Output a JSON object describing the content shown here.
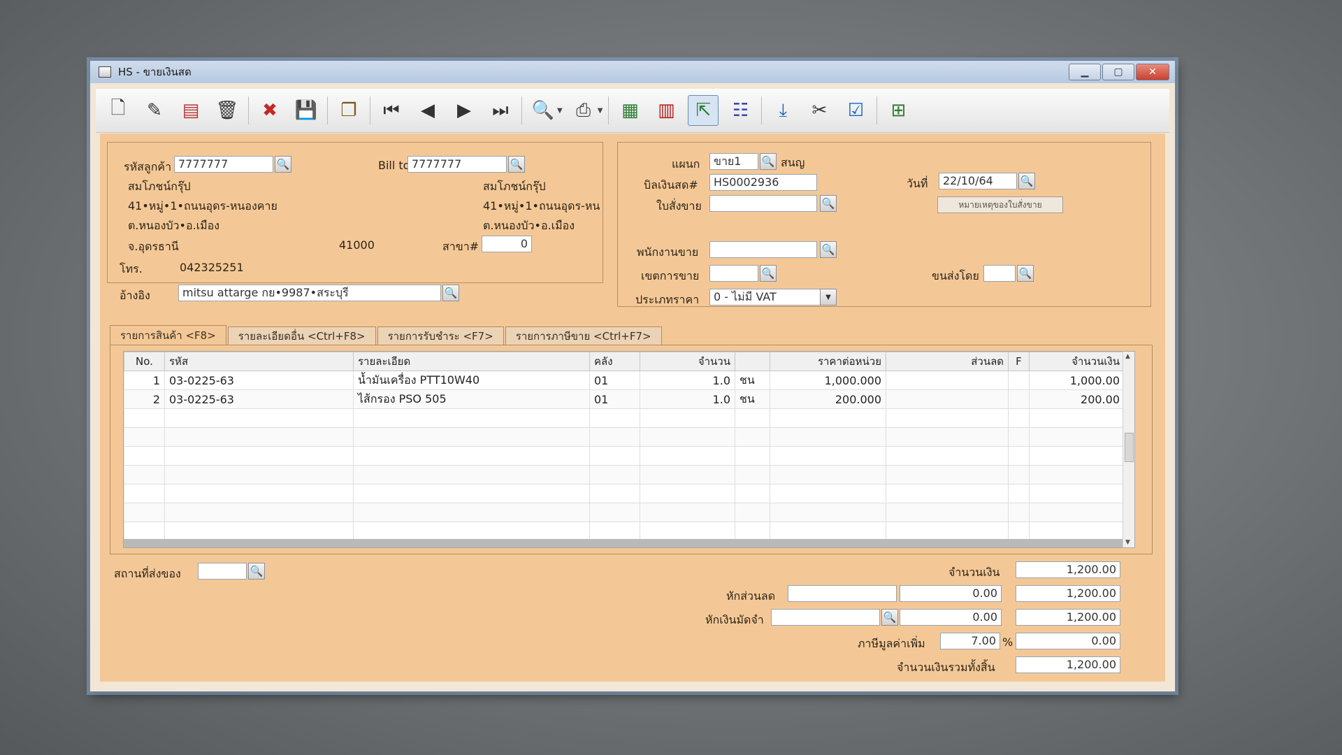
{
  "window": {
    "title": "HS - ขายเงินสด"
  },
  "toolbar": {
    "icons": [
      "new-doc-icon",
      "edit-icon",
      "void-icon",
      "trash-icon",
      "cancel-icon",
      "save-icon",
      "copy-icon",
      "first-icon",
      "prev-icon",
      "next-icon",
      "last-icon",
      "find-icon",
      "print-icon",
      "calc-icon",
      "register-icon",
      "checkout-icon",
      "report-icon",
      "approve-icon",
      "tools-icon",
      "ok-icon",
      "gift-icon"
    ]
  },
  "customer": {
    "code_label": "รหัสลูกค้า",
    "code": "7777777",
    "name": "สมโภชน์กรุ๊ป",
    "address1": "41•หมู่•1•ถนนอุดร-หนองคาย",
    "address2": "ต.หนองบัว•อ.เมือง",
    "province": "จ.อุดรธานี",
    "zip": "41000",
    "phone_label": "โทร.",
    "phone": "042325251",
    "ref_label": "อ้างอิง",
    "ref": "mitsu attarge กย•9987•สระบุรี"
  },
  "billto": {
    "label": "Bill to",
    "code": "7777777",
    "name": "สมโภชน์กรุ๊ป",
    "address1": "41•หมู่•1•ถนนอุดร-หน",
    "address2": "ต.หนองบัว•อ.เมือง",
    "branch_label": "สาขา#",
    "branch": "0"
  },
  "doc": {
    "dept_label": "แผนก",
    "dept": "ขาย1",
    "dept_name": "สนญ",
    "bill_label": "บิลเงินสด#",
    "bill": "HS0002936",
    "date_label": "วันที่",
    "date": "22/10/64",
    "order_label": "ใบสั่งขาย",
    "order": "",
    "note_button": "หมายเหตุของใบสั่งขาย",
    "sales_label": "พนักงานขาย",
    "sales": "",
    "area_label": "เขตการขาย",
    "area": "",
    "ship_label": "ขนส่งโดย",
    "ship": "",
    "price_label": "ประเภทราคา",
    "price_type": "0 - ไม่มี VAT"
  },
  "tabs": [
    "รายการสินค้า <F8>",
    "รายละเอียดอื่น <Ctrl+F8>",
    "รายการรับชำระ <F7>",
    "รายการภาษีขาย <Ctrl+F7>"
  ],
  "grid": {
    "headers": [
      "No.",
      "รหัส",
      "รายละเอียด",
      "คลัง",
      "จำนวน",
      "",
      "ราคาต่อหน่วย",
      "ส่วนลด",
      "F",
      "จำนวนเงิน"
    ],
    "rows": [
      {
        "no": "1",
        "code": "03-0225-63",
        "desc": "น้ำมันเครื่อง PTT10W40",
        "wh": "01",
        "qty": "1.0",
        "unit": "ชน",
        "price": "1,000.000",
        "disc": "",
        "f": "",
        "amount": "1,000.00"
      },
      {
        "no": "2",
        "code": "03-0225-63",
        "desc": "ไส้กรอง PSO 505",
        "wh": "01",
        "qty": "1.0",
        "unit": "ชน",
        "price": "200.000",
        "disc": "",
        "f": "",
        "amount": "200.00"
      }
    ]
  },
  "footer": {
    "place_label": "สถานที่ส่งของ",
    "place": "",
    "amount_label": "จำนวนเงิน",
    "amount": "1,200.00",
    "discount_label": "หักส่วนลด",
    "discount_code": "",
    "discount": "0.00",
    "after_discount": "1,200.00",
    "deposit_label": "หักเงินมัดจำ",
    "deposit_code": "",
    "deposit": "0.00",
    "after_deposit": "1,200.00",
    "vat_label": "ภาษีมูลค่าเพิ่ม",
    "vat_rate": "7.00",
    "vat_pct": "%",
    "vat": "0.00",
    "total_label": "จำนวนเงินรวมทั้งสิ้น",
    "total": "1,200.00"
  }
}
